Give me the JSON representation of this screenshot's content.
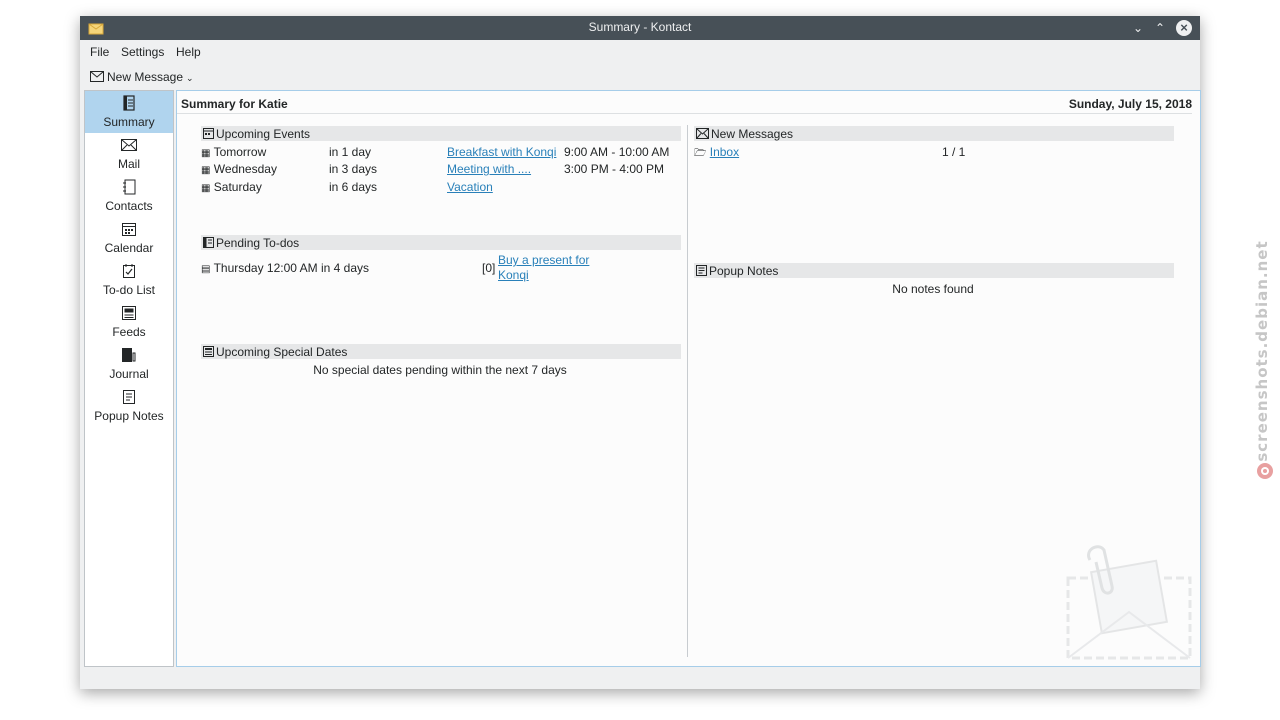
{
  "window": {
    "title": "Summary - Kontact"
  },
  "menu": {
    "file": "File",
    "settings": "Settings",
    "help": "Help"
  },
  "toolbar": {
    "new_message": "New Message"
  },
  "sidebar": {
    "items": [
      {
        "label": "Summary",
        "icon": "summary-icon"
      },
      {
        "label": "Mail",
        "icon": "mail-icon"
      },
      {
        "label": "Contacts",
        "icon": "contacts-icon"
      },
      {
        "label": "Calendar",
        "icon": "calendar-icon"
      },
      {
        "label": "To-do List",
        "icon": "todo-icon"
      },
      {
        "label": "Feeds",
        "icon": "feeds-icon"
      },
      {
        "label": "Journal",
        "icon": "journal-icon"
      },
      {
        "label": "Popup Notes",
        "icon": "notes-icon"
      }
    ]
  },
  "summary": {
    "title": "Summary for Katie",
    "date": "Sunday, July 15, 2018",
    "upcoming_events": {
      "heading": "Upcoming Events",
      "rows": [
        {
          "day": "Tomorrow",
          "when": "in 1 day",
          "title": "Breakfast with Konqi",
          "time": "9:00 AM - 10:00 AM"
        },
        {
          "day": "Wednesday",
          "when": "in 3 days",
          "title": "Meeting with ....",
          "time": "3:00 PM - 4:00 PM"
        },
        {
          "day": "Saturday",
          "when": "in 6 days",
          "title": "Vacation",
          "time": ""
        }
      ]
    },
    "pending_todos": {
      "heading": "Pending To-dos",
      "rows": [
        {
          "due": "Thursday 12:00 AM in 4 days",
          "priority": "[0]",
          "title_line1": "Buy a present for",
          "title_line2": "Konqi"
        }
      ]
    },
    "special_dates": {
      "heading": "Upcoming Special Dates",
      "empty": "No special dates pending within the next 7 days"
    },
    "new_messages": {
      "heading": "New Messages",
      "rows": [
        {
          "folder": "Inbox",
          "count": "1 / 1"
        }
      ]
    },
    "popup_notes": {
      "heading": "Popup Notes",
      "empty": "No notes found"
    }
  },
  "watermark": {
    "text": "screenshots.debian.net"
  },
  "colors": {
    "titlebar": "#475057",
    "accent": "#2980b9",
    "selection": "#b0d4ee",
    "window_bg": "#eff0f1"
  }
}
